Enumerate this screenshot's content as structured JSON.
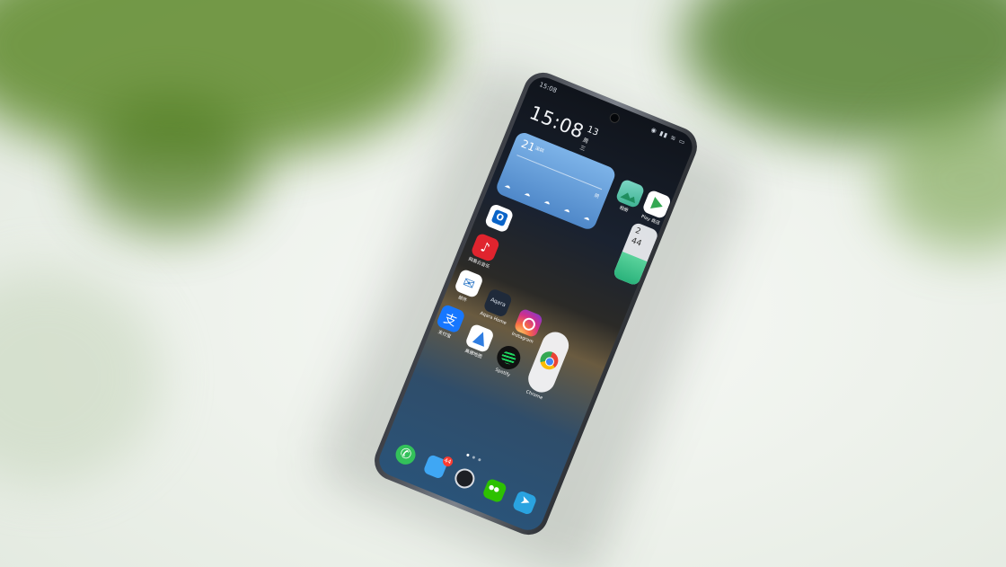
{
  "status_bar": {
    "time": "15:08",
    "icons": "◉ ▮▮ ≋ ▭"
  },
  "clock_widget": {
    "time": "15:08",
    "date": "13",
    "weekday": "周三"
  },
  "weather_widget": {
    "temperature": "21",
    "location": "深圳",
    "condition": "阴",
    "hours": [
      "☁",
      "☁",
      "☁",
      "☁",
      "☁"
    ]
  },
  "battery_widget": {
    "value_top": "2",
    "value_bottom": "44",
    "level_percent": 45
  },
  "apps": {
    "gallery": "相册",
    "play_store": "Play 商店",
    "outlook": "",
    "netease_music": "网易云音乐",
    "mail": "邮件",
    "aqara": "Aqara Home",
    "instagram": "Instagram",
    "alipay": "支付宝",
    "navi": "高德地图",
    "spotify": "Spotify",
    "chrome": "Chrome"
  },
  "dock": {
    "message_badge": "44"
  }
}
